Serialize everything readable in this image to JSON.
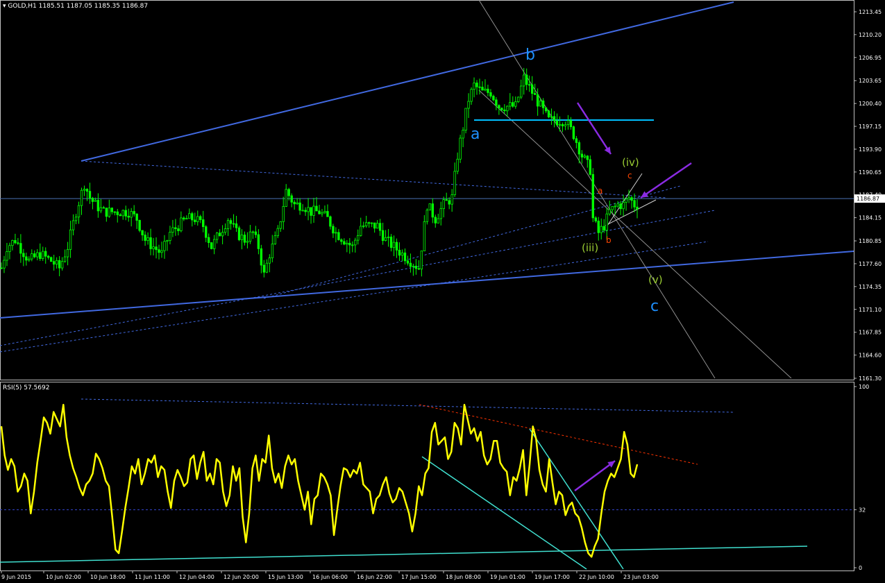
{
  "header": {
    "symbol": "GOLD,H1",
    "ohlc": "1185.51 1187.05 1185.35 1186.87",
    "rsi_label": "RSI(5) 57.5692"
  },
  "colors": {
    "background": "#000000",
    "frame": "#c0c0c0",
    "candles": "#00ff00",
    "rsi": "#ffff00",
    "channel": "#4169e1",
    "wave_major": "#1e90ff",
    "wave_minor": "#9acd32",
    "wave_sub": "#ff4500",
    "arrow": "#8a2be2",
    "trend_rsi": "#40e0d0",
    "red_trend": "#ff3300",
    "level_a": "#00bfff"
  },
  "chart_data": [
    {
      "type": "candlestick",
      "symbol": "GOLD,H1",
      "current_price": "1186.87",
      "y_ticks": [
        "1213.45",
        "1210.20",
        "1206.95",
        "1203.65",
        "1200.40",
        "1197.15",
        "1193.90",
        "1190.65",
        "1187.40",
        "1184.15",
        "1180.85",
        "1177.60",
        "1174.35",
        "1171.10",
        "1167.85",
        "1164.60",
        "1161.30"
      ],
      "ylim": [
        1161.3,
        1213.45
      ],
      "x_ticks": [
        "9 Jun 2015",
        "10 Jun 02:00",
        "10 Jun 18:00",
        "11 Jun 11:00",
        "12 Jun 04:00",
        "12 Jun 20:00",
        "15 Jun 13:00",
        "16 Jun 06:00",
        "16 Jun 22:00",
        "17 Jun 15:00",
        "18 Jun 08:00",
        "19 Jun 01:00",
        "19 Jun 17:00",
        "22 Jun 10:00",
        "23 Jun 03:00"
      ],
      "close_anchors": [
        [
          0,
          1177
        ],
        [
          2,
          1180
        ],
        [
          5,
          1181
        ],
        [
          10,
          1178
        ],
        [
          14,
          1179
        ],
        [
          18,
          1178
        ],
        [
          21,
          1177
        ],
        [
          24,
          1180
        ],
        [
          27,
          1185
        ],
        [
          30,
          1189
        ],
        [
          32,
          1187
        ],
        [
          34,
          1186
        ],
        [
          37,
          1185
        ],
        [
          40,
          1185
        ],
        [
          43,
          1185
        ],
        [
          46,
          1185
        ],
        [
          49,
          1184
        ],
        [
          52,
          1181
        ],
        [
          55,
          1180
        ],
        [
          58,
          1179
        ],
        [
          61,
          1182
        ],
        [
          64,
          1183
        ],
        [
          67,
          1184
        ],
        [
          70,
          1184
        ],
        [
          73,
          1183
        ],
        [
          76,
          1180
        ],
        [
          79,
          1182
        ],
        [
          82,
          1184
        ],
        [
          85,
          1182
        ],
        [
          88,
          1181
        ],
        [
          91,
          1182
        ],
        [
          93,
          1180
        ],
        [
          95,
          1176
        ],
        [
          97,
          1179
        ],
        [
          100,
          1182
        ],
        [
          103,
          1188
        ],
        [
          106,
          1186
        ],
        [
          109,
          1186
        ],
        [
          112,
          1185
        ],
        [
          115,
          1185
        ],
        [
          118,
          1184
        ],
        [
          121,
          1182
        ],
        [
          124,
          1181
        ],
        [
          127,
          1180
        ],
        [
          130,
          1183
        ],
        [
          133,
          1183
        ],
        [
          136,
          1183
        ],
        [
          139,
          1181
        ],
        [
          142,
          1180
        ],
        [
          145,
          1179
        ],
        [
          148,
          1178
        ],
        [
          151,
          1177
        ],
        [
          152,
          1180
        ],
        [
          154,
          1186
        ],
        [
          157,
          1184
        ],
        [
          160,
          1186
        ],
        [
          163,
          1187
        ],
        [
          165,
          1193
        ],
        [
          167,
          1197
        ],
        [
          169,
          1201
        ],
        [
          171,
          1203
        ],
        [
          174,
          1202
        ],
        [
          177,
          1202
        ],
        [
          180,
          1200
        ],
        [
          183,
          1200
        ],
        [
          186,
          1200
        ],
        [
          189,
          1204
        ],
        [
          192,
          1202
        ],
        [
          195,
          1200
        ],
        [
          198,
          1198
        ],
        [
          201,
          1198
        ],
        [
          204,
          1198
        ],
        [
          207,
          1196
        ],
        [
          210,
          1193
        ],
        [
          213,
          1191
        ],
        [
          214,
          1184
        ],
        [
          216,
          1182
        ],
        [
          218,
          1183
        ],
        [
          220,
          1185
        ],
        [
          223,
          1186
        ],
        [
          225,
          1186
        ],
        [
          227,
          1187
        ],
        [
          229,
          1186
        ]
      ],
      "wave_labels": [
        {
          "text": "a",
          "role": "major"
        },
        {
          "text": "b",
          "role": "major"
        },
        {
          "text": "c",
          "role": "major"
        },
        {
          "text": "(iii)",
          "role": "minor"
        },
        {
          "text": "(iv)",
          "role": "minor"
        },
        {
          "text": "(v)",
          "role": "minor"
        },
        {
          "text": "a",
          "role": "sub"
        },
        {
          "text": "b",
          "role": "sub"
        },
        {
          "text": "c",
          "role": "sub"
        }
      ]
    },
    {
      "type": "line",
      "title": "RSI(5) 57.5692",
      "y_ticks": [
        "100",
        "32",
        "0"
      ],
      "ylim": [
        0,
        100
      ],
      "levels": [
        32
      ],
      "values": [
        78,
        62,
        54,
        60,
        56,
        42,
        45,
        52,
        48,
        30,
        42,
        58,
        70,
        83,
        80,
        74,
        86,
        82,
        78,
        90,
        72,
        62,
        55,
        50,
        44,
        40,
        46,
        48,
        52,
        63,
        60,
        55,
        48,
        45,
        28,
        10,
        8,
        20,
        33,
        44,
        56,
        52,
        60,
        46,
        52,
        60,
        58,
        62,
        50,
        56,
        54,
        42,
        33,
        48,
        54,
        50,
        45,
        47,
        60,
        62,
        49,
        58,
        64,
        48,
        52,
        46,
        60,
        58,
        42,
        34,
        40,
        56,
        48,
        55,
        28,
        14,
        30,
        55,
        62,
        48,
        60,
        58,
        73,
        55,
        47,
        52,
        44,
        56,
        62,
        57,
        60,
        48,
        40,
        32,
        42,
        24,
        38,
        40,
        52,
        50,
        46,
        40,
        18,
        32,
        45,
        55,
        54,
        50,
        54,
        52,
        58,
        46,
        44,
        42,
        30,
        38,
        40,
        46,
        50,
        41,
        36,
        38,
        44,
        42,
        36,
        30,
        20,
        30,
        45,
        40,
        52,
        55,
        75,
        80,
        68,
        70,
        72,
        60,
        64,
        80,
        77,
        68,
        90,
        82,
        74,
        77,
        70,
        75,
        62,
        57,
        60,
        70,
        70,
        58,
        55,
        53,
        40,
        50,
        48,
        55,
        65,
        40,
        57,
        78,
        71,
        54,
        46,
        42,
        60,
        47,
        35,
        42,
        40,
        29,
        34,
        36,
        30,
        28,
        22,
        14,
        8,
        6,
        12,
        16,
        30,
        42,
        48,
        52,
        50,
        55,
        60,
        75,
        68,
        52,
        50,
        57
      ]
    }
  ]
}
